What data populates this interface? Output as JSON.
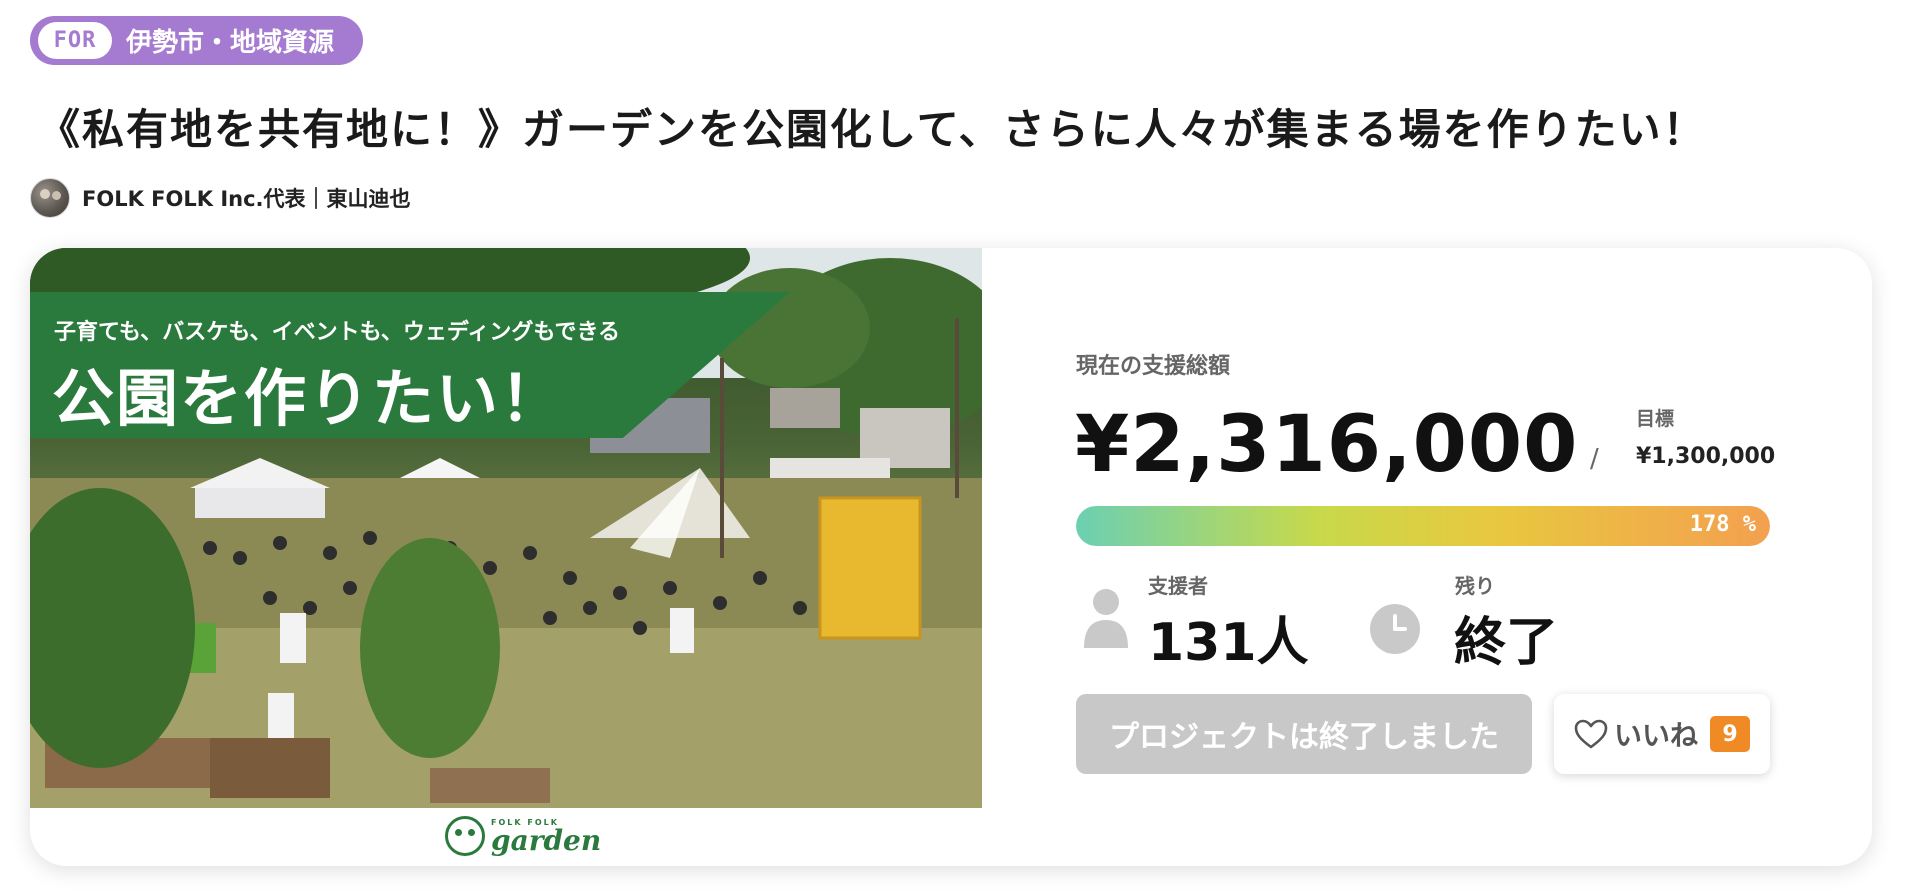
{
  "category_tag": {
    "prefix": "FOR",
    "label": "伊勢市・地域資源"
  },
  "project": {
    "title": "《私有地を共有地に！》ガーデンを公園化して、さらに人々が集まる場を作りたい！",
    "owner": "FOLK FOLK Inc.代表｜東山迪也"
  },
  "hero": {
    "banner_sub": "子育ても、バスケも、イベントも、ウェディングもできる",
    "banner_main": "公園を作りたい！",
    "logo_small": "FOLK FOLK",
    "logo_big": "garden"
  },
  "stats": {
    "current_label": "現在の支援総額",
    "current_amount": "¥2,316,000",
    "goal_separator": "/",
    "goal_label": "目標",
    "goal_amount": "¥1,300,000",
    "progress_percent": 178,
    "progress_text": "178 %",
    "supporters_label": "支援者",
    "supporters_value": "131人",
    "remaining_label": "残り",
    "remaining_value": "終了"
  },
  "actions": {
    "ended_button": "プロジェクトは終了しました",
    "like_label": "いいね",
    "like_count": "9"
  },
  "colors": {
    "tag_purple": "#a57ad1",
    "banner_green": "#2b7a3d",
    "like_badge_orange": "#f08a24",
    "progress_gradient_start": "#6bd0b2",
    "progress_gradient_end": "#f3a04f",
    "disabled_button_gray": "#c8c8c8"
  },
  "icons": [
    "person-icon",
    "clock-icon",
    "heart-icon",
    "avatar"
  ]
}
